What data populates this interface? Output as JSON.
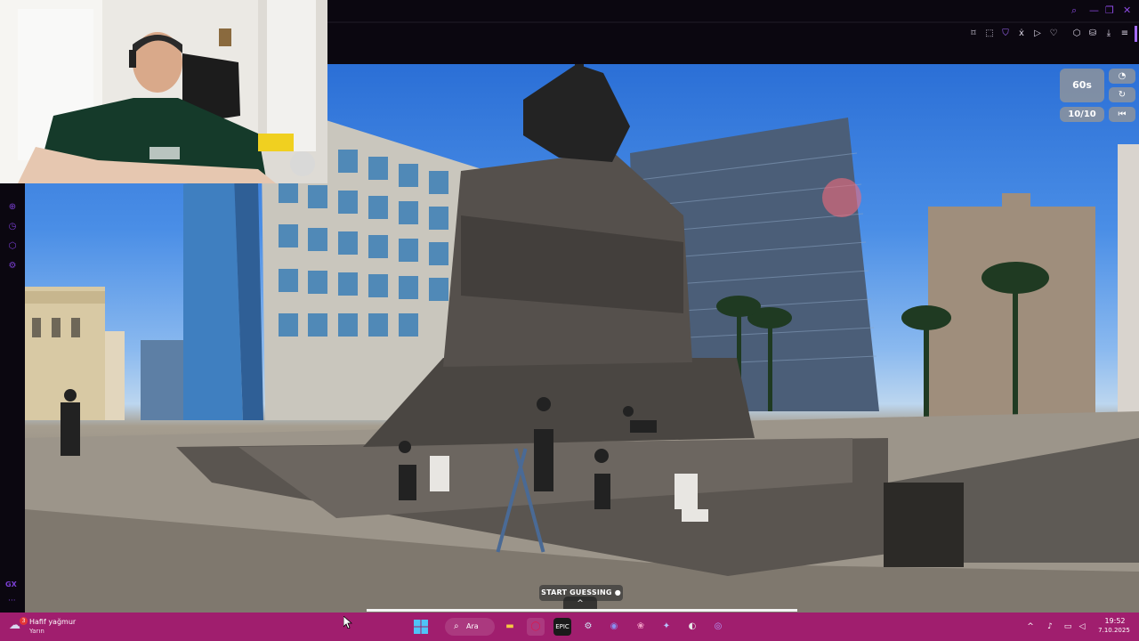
{
  "browser": {
    "window_controls": [
      "search-icon",
      "minimize-icon",
      "restore-icon",
      "close-icon"
    ],
    "toolbar_icons": [
      "bookmark-icon",
      "snapshot-icon",
      "shield-icon",
      "translate-icon",
      "play-icon",
      "heart-icon",
      "extensions-icon",
      "wallet-icon",
      "download-icon",
      "menu-icon"
    ],
    "accent_color": "#a36bff"
  },
  "sidebar": {
    "icons": [
      "add-icon",
      "history-icon",
      "extensions-icon",
      "settings-icon"
    ],
    "gx_label": "GX",
    "more_label": "···"
  },
  "game": {
    "timer": "60s",
    "round": "10/10",
    "icons": [
      "compass-icon",
      "refresh-icon",
      "rewind-icon"
    ],
    "start_guessing": "START GUESSING",
    "expand_symbol": "^"
  },
  "taskbar": {
    "weather_title": "Hafif yağmur",
    "weather_subtitle": "Yarın",
    "weather_badge": "3",
    "search_label": "Ara",
    "apps": [
      "start-icon",
      "search-icon",
      "file-explorer-icon",
      "opera-gx-icon",
      "epic-games-icon",
      "steam-icon",
      "discord-icon",
      "photos-icon",
      "app-icon",
      "obs-icon",
      "chat-icon"
    ],
    "tray_icons": [
      "chevron-up-icon",
      "microphone-icon",
      "display-icon",
      "volume-icon"
    ],
    "clock_time": "19:52",
    "clock_date": "7.10.2025",
    "color": "#a01e6e"
  }
}
